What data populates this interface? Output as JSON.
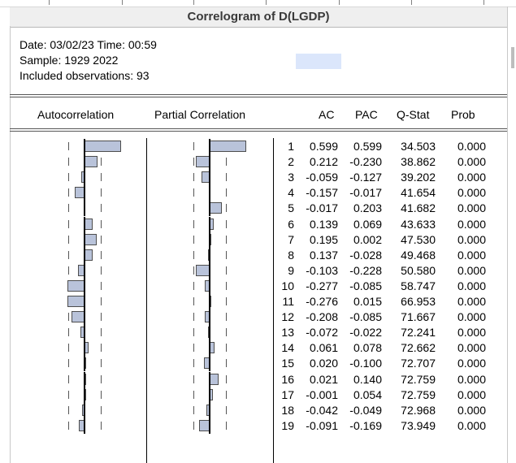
{
  "window": {
    "title": "Correlogram of D(LGDP)"
  },
  "meta": {
    "date_line": "Date: 03/02/23   Time: 00:59",
    "sample_line": "Sample: 1929 2022",
    "obs_line": "Included observations: 93"
  },
  "headers": {
    "acf": "Autocorrelation",
    "pacf": "Partial Correlation",
    "ac": "AC",
    "pac": "PAC",
    "qstat": "Q-Stat",
    "prob": "Prob"
  },
  "chart_data": {
    "type": "table",
    "lags": [
      1,
      2,
      3,
      4,
      5,
      6,
      7,
      8,
      9,
      10,
      11,
      12,
      13,
      14,
      15,
      16,
      17,
      18,
      19
    ],
    "ac": [
      0.599,
      0.212,
      -0.059,
      -0.157,
      -0.017,
      0.139,
      0.195,
      0.137,
      -0.103,
      -0.277,
      -0.276,
      -0.208,
      -0.072,
      0.061,
      0.02,
      0.021,
      -0.001,
      -0.042,
      -0.091
    ],
    "pac": [
      0.599,
      -0.23,
      -0.127,
      -0.017,
      0.203,
      0.069,
      0.002,
      -0.028,
      -0.228,
      -0.085,
      0.015,
      -0.085,
      -0.022,
      0.078,
      -0.1,
      0.14,
      0.054,
      -0.049,
      -0.169
    ],
    "q_stat": [
      34.503,
      38.862,
      39.202,
      41.654,
      41.682,
      43.633,
      47.53,
      49.468,
      50.58,
      58.747,
      66.953,
      71.667,
      72.241,
      72.662,
      72.707,
      72.759,
      72.759,
      72.968,
      73.949
    ],
    "prob": [
      0.0,
      0.0,
      0.0,
      0.0,
      0.0,
      0.0,
      0.0,
      0.0,
      0.0,
      0.0,
      0.0,
      0.0,
      0.0,
      0.0,
      0.0,
      0.0,
      0.0,
      0.0,
      0.0
    ]
  }
}
